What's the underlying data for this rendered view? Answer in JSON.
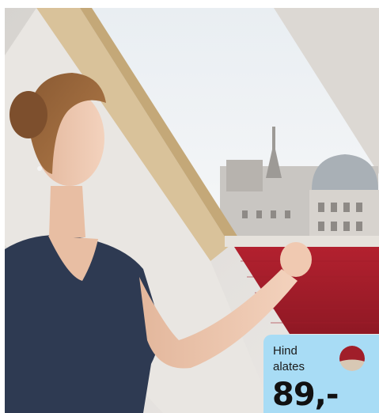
{
  "product_photo": {
    "icon": "woman-opening-roof-window-blind-photo"
  },
  "price_card": {
    "label_line1": "Hind",
    "label_line2": "alates",
    "price": "89,-",
    "color_swatch_icon": "red-blind-swatch-icon",
    "colors": {
      "card_background": "#a8dcf5",
      "swatch_top": "#a01e2a",
      "swatch_bottom": "#d8c8b4"
    }
  }
}
